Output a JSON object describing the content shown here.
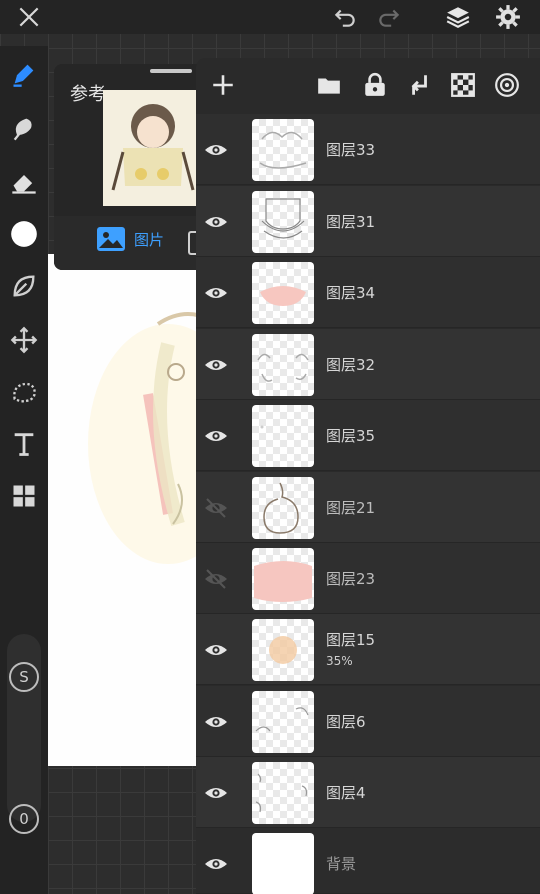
{
  "topbar": {
    "close_icon": "close-icon",
    "undo_icon": "undo-icon",
    "redo_icon": "redo-icon",
    "layers_icon": "layers-icon",
    "settings_icon": "gear-icon"
  },
  "left_tools": {
    "items": [
      "pen-tool",
      "smudge-tool",
      "eraser-tool",
      "color-swatch",
      "leaf-tool",
      "move-tool",
      "lasso-tool",
      "text-tool",
      "more-tools"
    ],
    "brush_size_label": "S",
    "opacity_label": "0"
  },
  "reference_panel": {
    "title": "参考",
    "image_tab_label": "图片"
  },
  "layers_panel": {
    "add_icon": "plus-icon",
    "folder_icon": "folder-icon",
    "lock_icon": "lock-icon",
    "merge_down_icon": "merge-down-icon",
    "transparency_icon": "checker-icon",
    "target_icon": "target-icon",
    "layers": [
      {
        "name": "图层33",
        "visible": true
      },
      {
        "name": "图层31",
        "visible": true
      },
      {
        "name": "图层34",
        "visible": true
      },
      {
        "name": "图层32",
        "visible": true
      },
      {
        "name": "图层35",
        "visible": true
      },
      {
        "name": "图层21",
        "visible": false
      },
      {
        "name": "图层23",
        "visible": false
      },
      {
        "name": "图层15",
        "visible": true,
        "opacity": "35%"
      },
      {
        "name": "图层6",
        "visible": true
      },
      {
        "name": "图层4",
        "visible": true
      },
      {
        "name": "背景",
        "visible": true
      }
    ]
  },
  "colors": {
    "accent": "#3ea0ff",
    "panel_bg": "#2a2a2a",
    "toolbar_bg": "#232323"
  }
}
